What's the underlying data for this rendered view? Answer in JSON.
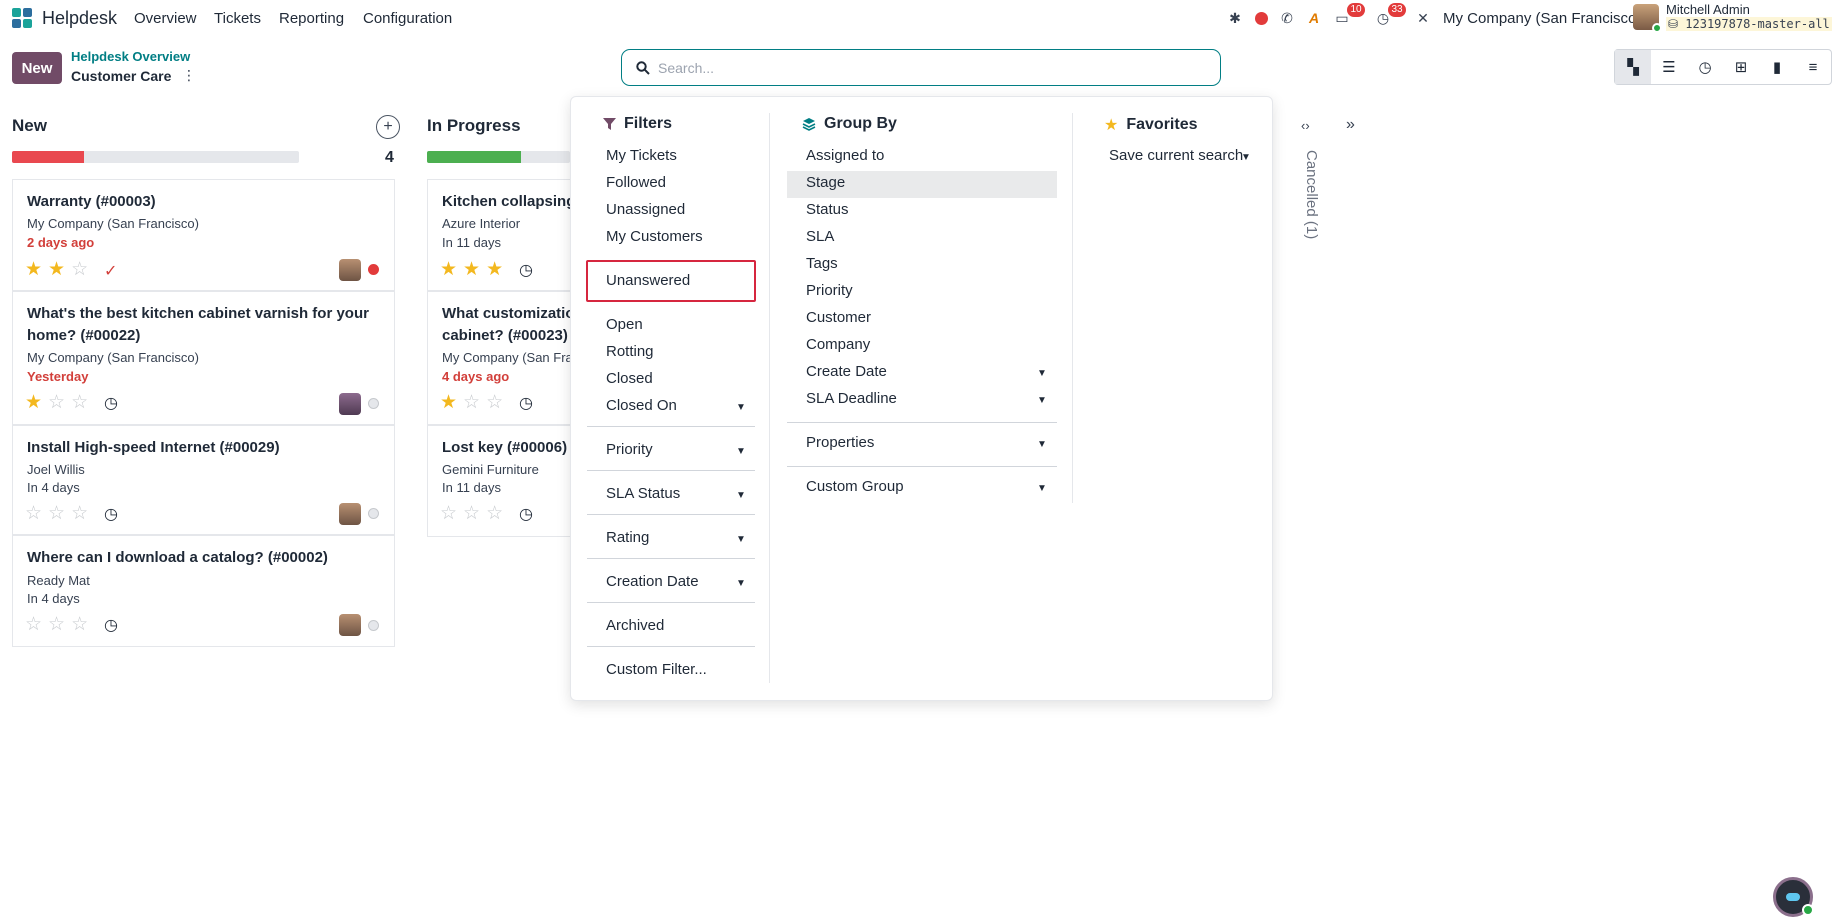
{
  "navbar": {
    "app_name": "Helpdesk",
    "menus": [
      "Overview",
      "Tickets",
      "Reporting",
      "Configuration"
    ],
    "messages_badge": "10",
    "activities_badge": "33",
    "company": "My Company (San Francisco)",
    "user_name": "Mitchell Admin",
    "database": "123197878-master-all"
  },
  "control_panel": {
    "new_label": "New",
    "breadcrumb_parent": "Helpdesk Overview",
    "breadcrumb_current": "Customer Care",
    "search_placeholder": "Search..."
  },
  "kanban": {
    "columns": [
      {
        "title": "New",
        "count": "4",
        "progress_red": 0.25,
        "cards": [
          {
            "title": "Warranty (#00003)",
            "customer": "My Company (San Francisco)",
            "date": "2 days ago",
            "date_overdue": true,
            "stars": 2,
            "status": "red"
          },
          {
            "title": "What's the best kitchen cabinet varnish for your home? (#00022)",
            "customer": "My Company (San Francisco)",
            "date": "Yesterday",
            "date_overdue": true,
            "stars": 1,
            "status": "grey"
          },
          {
            "title": "Install High-speed Internet (#00029)",
            "customer": "Joel Willis",
            "date": "In 4 days",
            "date_overdue": false,
            "stars": 0,
            "status": "grey"
          },
          {
            "title": "Where can I download a catalog? (#00002)",
            "customer": "Ready Mat",
            "date": "In 4 days",
            "date_overdue": false,
            "stars": 0,
            "status": "grey"
          }
        ]
      },
      {
        "title": "In Progress",
        "progress_green": 0.33,
        "cards": [
          {
            "title": "Kitchen collapsing",
            "customer": "Azure Interior",
            "date": "In 11 days",
            "date_overdue": false,
            "stars": 3
          },
          {
            "title": "What customizatio",
            "title_line2": "cabinet? (#00023)",
            "customer": "My Company (San Fra",
            "date": "4 days ago",
            "date_overdue": true,
            "stars": 1
          },
          {
            "title": "Lost key (#00006)",
            "customer": "Gemini Furniture",
            "date": "In 11 days",
            "date_overdue": false,
            "stars": 0
          }
        ]
      }
    ],
    "folded_column": "Cancelled (1)"
  },
  "search_panel": {
    "filters": {
      "title": "Filters",
      "group1": [
        "My Tickets",
        "Followed",
        "Unassigned",
        "My Customers"
      ],
      "focused": "Unanswered",
      "group2": [
        "Open",
        "Rotting",
        "Closed",
        "Closed On"
      ],
      "dropdowns": [
        "Priority",
        "SLA Status",
        "Rating",
        "Creation Date"
      ],
      "archived": "Archived",
      "custom": "Custom Filter..."
    },
    "group_by": {
      "title": "Group By",
      "items": [
        "Assigned to",
        "Stage",
        "Status",
        "SLA",
        "Tags",
        "Priority",
        "Customer",
        "Company",
        "Create Date",
        "SLA Deadline"
      ],
      "properties": "Properties",
      "custom_group": "Custom Group"
    },
    "favorites": {
      "title": "Favorites",
      "save_search": "Save current search"
    }
  },
  "colors": {
    "brand": "#714b67",
    "accent": "#017e84",
    "danger": "#d23f3a",
    "success": "#4caf50",
    "star": "#f3b81f"
  }
}
